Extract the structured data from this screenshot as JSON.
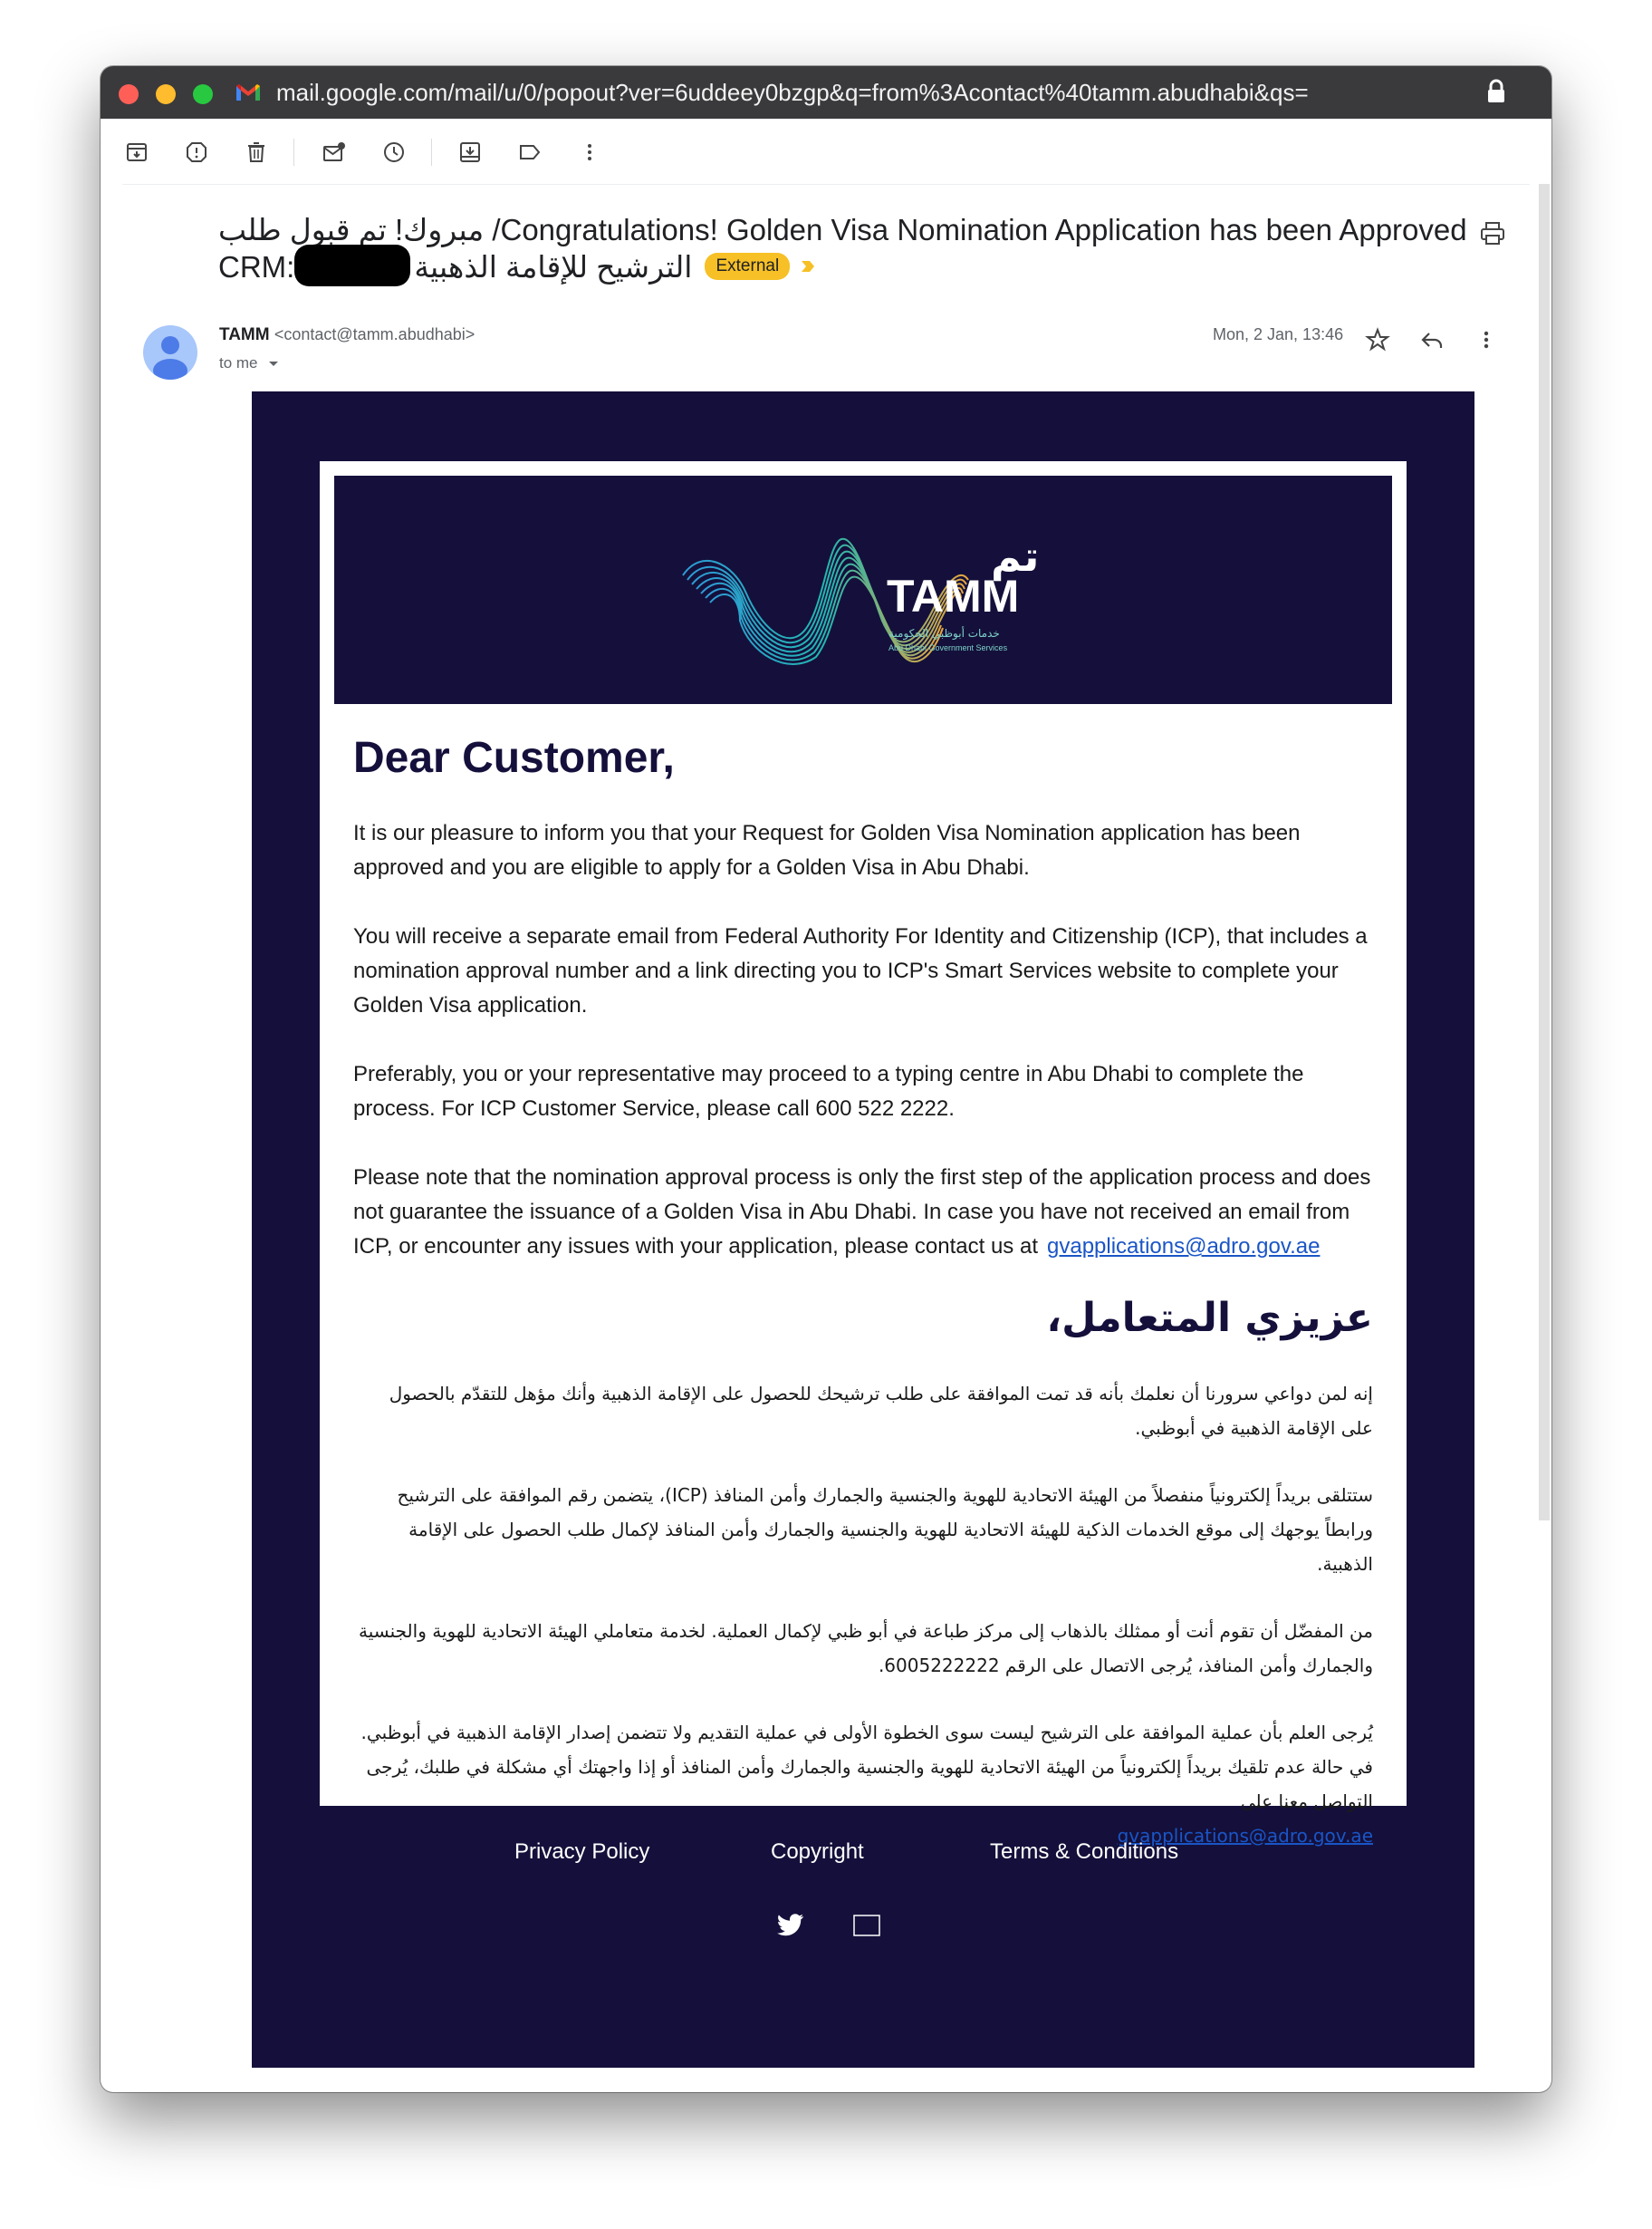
{
  "browser": {
    "url": "mail.google.com/mail/u/0/popout?ver=6uddeey0bzgp&q=from%3Acontact%40tamm.abudhabi&qs="
  },
  "toolbar": {
    "icons": [
      "archive-icon",
      "report-spam-icon",
      "delete-icon",
      "mark-unread-icon",
      "snooze-icon",
      "move-to-icon",
      "label-icon",
      "more-icon"
    ]
  },
  "message": {
    "subject_line1": "مبروك! تم قبول طلب /Congratulations! Golden Visa Nomination Application has been Approved",
    "subject_line2_prefix": "CRM:",
    "subject_line2_ar": "الترشيح للإقامة الذهبية",
    "badge": "External",
    "sender_name": "TAMM",
    "sender_address": "<contact@tamm.abudhabi>",
    "to_me": "to me",
    "date": "Mon, 2 Jan, 13:46"
  },
  "email": {
    "logo": {
      "ar_name": "تم",
      "name": "TAMM",
      "ar_tagline": "خدمات أبوظبي الحكومية",
      "tagline": "Abu Dhabi Government Services"
    },
    "greeting": "Dear Customer,",
    "para1": "It is our pleasure to inform you that your Request for Golden Visa Nomination application has been approved and you are eligible to apply for a Golden Visa in Abu Dhabi.",
    "para2": "You will receive a separate email from Federal Authority For Identity and Citizenship (ICP), that includes a nomination approval number and a link directing you to ICP's Smart Services website to complete your Golden Visa application.",
    "para3": "Preferably, you or your representative may proceed to a typing centre in Abu Dhabi to complete the process. For ICP Customer Service, please call 600 522 2222.",
    "para4": "Please note that the nomination approval process is only the first step of the application process and does not guarantee the issuance of a Golden Visa in Abu Dhabi. In case you have not received an email from ICP, or encounter any issues with your application, please contact us at",
    "email_link": "gvapplications@adro.gov.ae",
    "ar_greeting": "عزيزي المتعامل،",
    "ar_para1": "إنه لمن دواعي سرورنا أن نعلمك بأنه قد تمت الموافقة على طلب ترشيحك للحصول على الإقامة الذهبية وأنك مؤهل للتقدّم بالحصول على الإقامة الذهبية في أبوظبي.",
    "ar_para2": "ستتلقى بريداً إلكترونياً منفصلاً من الهيئة الاتحادية للهوية والجنسية والجمارك وأمن المنافذ (ICP)، يتضمن رقم الموافقة على الترشيح ورابطاً يوجهك إلى موقع الخدمات الذكية للهيئة الاتحادية للهوية والجنسية والجمارك وأمن المنافذ لإكمال طلب الحصول على الإقامة الذهبية.",
    "ar_para3": "من المفضّل أن تقوم أنت أو ممثلك بالذهاب إلى مركز طباعة في أبو ظبي لإكمال العملية. لخدمة متعاملي الهيئة الاتحادية للهوية والجنسية والجمارك وأمن المنافذ، يُرجى الاتصال على الرقم 6005222222.",
    "ar_para4": "يُرجى العلم بأن عملية الموافقة على الترشيح ليست سوى الخطوة الأولى في عملية التقديم ولا تتضمن إصدار الإقامة الذهبية في أبوظبي. في حالة عدم تلقيك بريداً إلكترونياً من الهيئة الاتحادية للهوية والجنسية والجمارك وأمن المنافذ أو إذا واجهتك أي مشكلة في طلبك، يُرجى التواصل معنا على",
    "footer": {
      "privacy": "Privacy Policy",
      "copyright": "Copyright",
      "terms": "Terms & Conditions"
    }
  },
  "colors": {
    "navy": "#14103b",
    "badge": "#f6c026",
    "link": "#1a55c6"
  }
}
